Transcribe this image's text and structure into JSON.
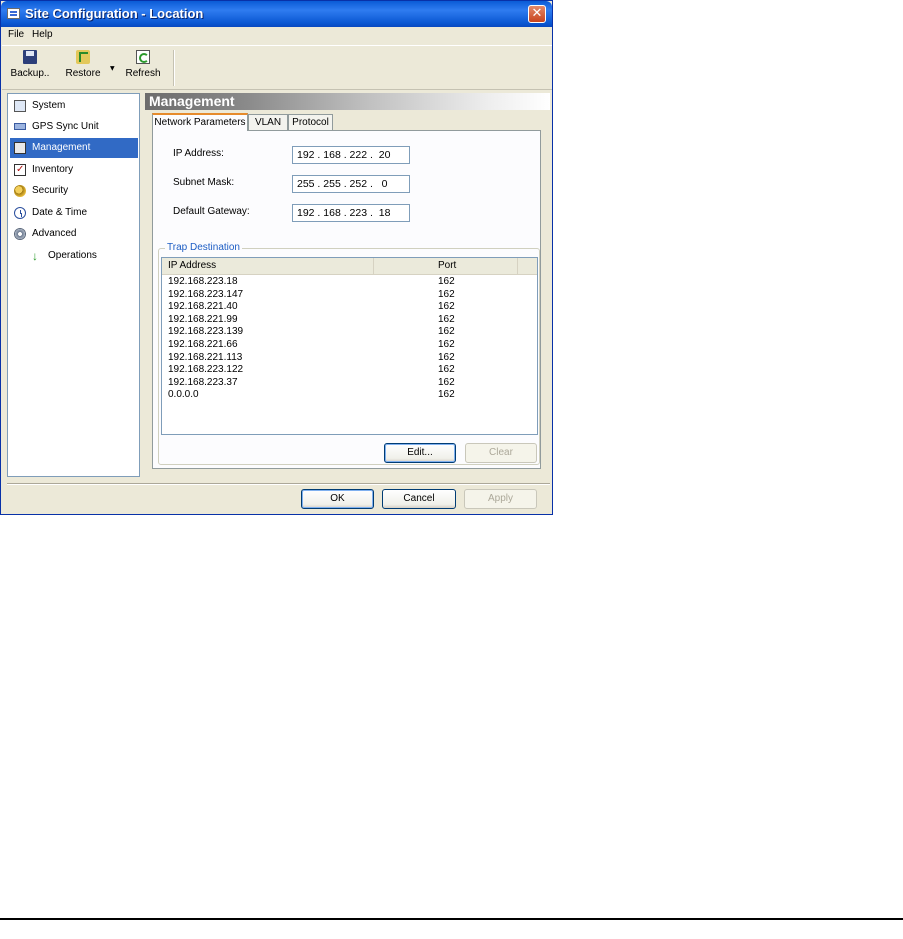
{
  "window": {
    "title": "Site Configuration - Location",
    "close_glyph": "✕"
  },
  "menu": [
    "File",
    "Help"
  ],
  "toolbar": {
    "backup_label": "Backup..",
    "restore_label": "Restore",
    "refresh_label": "Refresh",
    "dropdown_glyph": "▼"
  },
  "sidebar": {
    "items": [
      {
        "label": "System",
        "icon": "system-icon"
      },
      {
        "label": "GPS Sync Unit",
        "icon": "gps-icon"
      },
      {
        "label": "Management",
        "icon": "management-icon",
        "selected": true
      },
      {
        "label": "Inventory",
        "icon": "inventory-icon"
      },
      {
        "label": "Security",
        "icon": "security-icon"
      },
      {
        "label": "Date & Time",
        "icon": "clock-icon"
      },
      {
        "label": "Advanced",
        "icon": "gear-icon"
      },
      {
        "label": "Operations",
        "icon": "arrow-down-icon"
      }
    ]
  },
  "content": {
    "header": "Management",
    "tabs": [
      "Network Parameters",
      "VLAN",
      "Protocol"
    ],
    "active_tab": "Network Parameters",
    "fields": {
      "ip_label": "IP Address:",
      "ip_value": "192 . 168 . 222 .  20",
      "mask_label": "Subnet Mask:",
      "mask_value": "255 . 255 . 252 .   0",
      "gateway_label": "Default Gateway:",
      "gateway_value": "192 . 168 . 223 .  18"
    },
    "trap": {
      "title": "Trap Destination",
      "col_ip": "IP Address",
      "col_port": "Port",
      "rows": [
        {
          "ip": "192.168.223.18",
          "port": "162"
        },
        {
          "ip": "192.168.223.147",
          "port": "162"
        },
        {
          "ip": "192.168.221.40",
          "port": "162"
        },
        {
          "ip": "192.168.221.99",
          "port": "162"
        },
        {
          "ip": "192.168.223.139",
          "port": "162"
        },
        {
          "ip": "192.168.221.66",
          "port": "162"
        },
        {
          "ip": "192.168.221.113",
          "port": "162"
        },
        {
          "ip": "192.168.223.122",
          "port": "162"
        },
        {
          "ip": "192.168.223.37",
          "port": "162"
        },
        {
          "ip": "0.0.0.0",
          "port": "162"
        }
      ],
      "edit_label": "Edit...",
      "clear_label": "Clear"
    }
  },
  "footer": {
    "ok_label": "OK",
    "cancel_label": "Cancel",
    "apply_label": "Apply"
  }
}
